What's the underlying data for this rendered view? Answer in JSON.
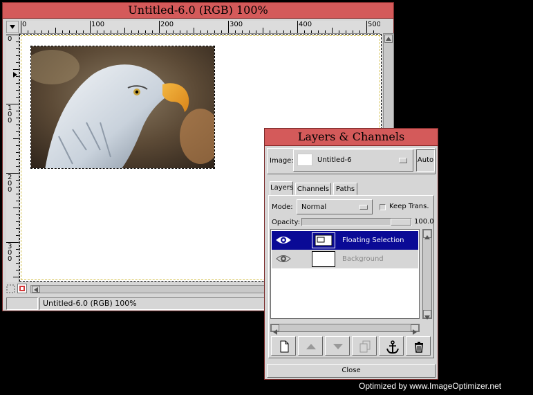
{
  "image_window": {
    "title": "Untitled-6.0 (RGB) 100%",
    "status_text": "Untitled-6.0 (RGB) 100%",
    "ruler_h_labels": [
      "0",
      "100",
      "200",
      "300",
      "400",
      "500"
    ],
    "ruler_v_labels": [
      "0",
      "100",
      "200",
      "300"
    ]
  },
  "layers_dialog": {
    "title": "Layers & Channels",
    "image_label": "Image:",
    "image_selected": "Untitled-6",
    "auto_button": "Auto",
    "tabs": [
      "Layers",
      "Channels",
      "Paths"
    ],
    "mode_label": "Mode:",
    "mode_value": "Normal",
    "keep_trans_label": "Keep Trans.",
    "keep_trans_checked": false,
    "opacity_label": "Opacity:",
    "opacity_value": "100.0",
    "layers": [
      {
        "name": "Floating Selection",
        "selected": true,
        "visible": true
      },
      {
        "name": "Background",
        "selected": false,
        "visible": true
      }
    ],
    "buttons": [
      "new-layer-icon",
      "raise-layer-icon",
      "lower-layer-icon",
      "duplicate-layer-icon",
      "anchor-icon",
      "trash-icon"
    ],
    "close_label": "Close"
  },
  "watermark": "Optimized by www.ImageOptimizer.net",
  "colors": {
    "titlebar": "#d45a5a",
    "selection": "#0a0a96",
    "window_bg": "#d6d6d6"
  }
}
